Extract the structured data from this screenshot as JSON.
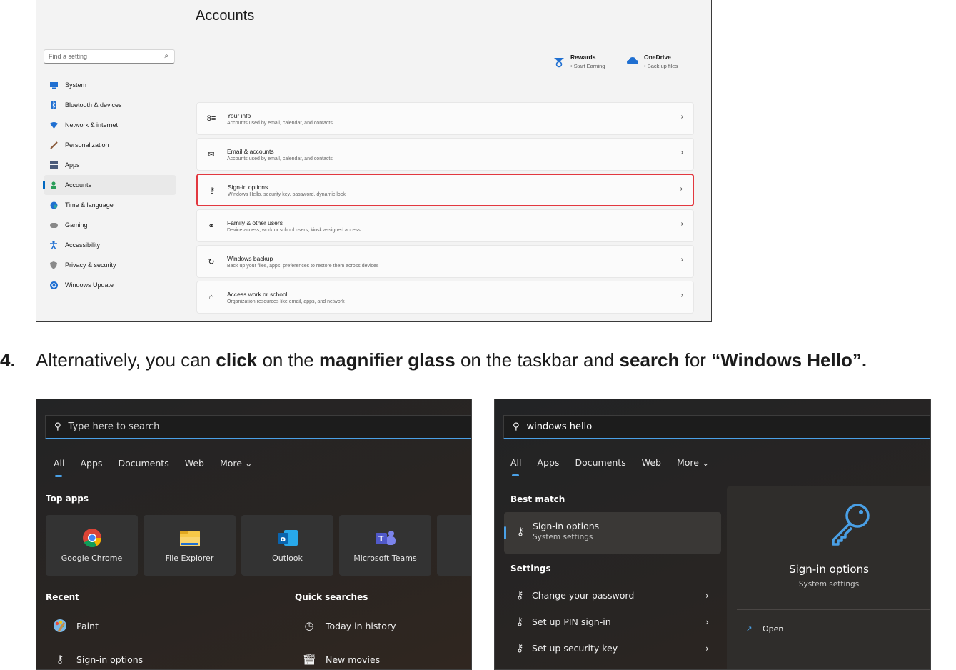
{
  "settings": {
    "title": "Accounts",
    "search_placeholder": "Find a setting",
    "nav": [
      {
        "label": "System",
        "icon": "monitor-icon",
        "color": "#1f6fd1"
      },
      {
        "label": "Bluetooth & devices",
        "icon": "bluetooth-icon",
        "color": "#1f6fd1"
      },
      {
        "label": "Network & internet",
        "icon": "wifi-icon",
        "color": "#1f6fd1"
      },
      {
        "label": "Personalization",
        "icon": "brush-icon",
        "color": "#8a5a3a"
      },
      {
        "label": "Apps",
        "icon": "apps-icon",
        "color": "#4a5a7a"
      },
      {
        "label": "Accounts",
        "icon": "person-icon",
        "color": "#2a9d58"
      },
      {
        "label": "Time & language",
        "icon": "globe-clock-icon",
        "color": "#1f6fd1"
      },
      {
        "label": "Gaming",
        "icon": "gamepad-icon",
        "color": "#777777"
      },
      {
        "label": "Accessibility",
        "icon": "accessibility-icon",
        "color": "#1f6fd1"
      },
      {
        "label": "Privacy & security",
        "icon": "shield-icon",
        "color": "#777777"
      },
      {
        "label": "Windows Update",
        "icon": "update-icon",
        "color": "#1f6fd1"
      }
    ],
    "active_nav": "Accounts",
    "promos": [
      {
        "title": "Rewards",
        "sub": "• Start Earning",
        "icon": "rewards-icon"
      },
      {
        "title": "OneDrive",
        "sub": "• Back up files",
        "icon": "cloud-icon"
      }
    ],
    "cards": [
      {
        "title": "Your info",
        "sub": "Accounts used by email, calendar, and contacts",
        "icon": "user-info-icon",
        "glyph": "8≡"
      },
      {
        "title": "Email & accounts",
        "sub": "Accounts used by email, calendar, and contacts",
        "icon": "mail-icon",
        "glyph": "✉"
      },
      {
        "title": "Sign-in options",
        "sub": "Windows Hello, security key, password, dynamic lock",
        "icon": "key-icon",
        "glyph": "⚷",
        "highlighted": true
      },
      {
        "title": "Family & other users",
        "sub": "Device access, work or school users, kiosk assigned access",
        "icon": "family-icon",
        "glyph": "⚭"
      },
      {
        "title": "Windows backup",
        "sub": "Back up your files, apps, preferences to restore them across devices",
        "icon": "backup-icon",
        "glyph": "↻"
      },
      {
        "title": "Access work or school",
        "sub": "Organization resources like email, apps, and network",
        "icon": "briefcase-icon",
        "glyph": "⌂"
      }
    ]
  },
  "instruction": {
    "number": "4.",
    "parts": [
      {
        "text": "Alternatively, you can ",
        "bold": false
      },
      {
        "text": "click",
        "bold": true
      },
      {
        "text": " on the ",
        "bold": false
      },
      {
        "text": "magnifier glass",
        "bold": true
      },
      {
        "text": " on the taskbar and ",
        "bold": false
      },
      {
        "text": "search",
        "bold": true
      },
      {
        "text": " for ",
        "bold": false
      },
      {
        "text": "“Windows Hello”.",
        "bold": true
      }
    ]
  },
  "search_left": {
    "placeholder": "Type here to search",
    "tabs": [
      "All",
      "Apps",
      "Documents",
      "Web",
      "More ⌄"
    ],
    "top_apps_label": "Top apps",
    "top_apps": [
      {
        "label": "Google Chrome",
        "icon": "chrome-icon"
      },
      {
        "label": "File Explorer",
        "icon": "folder-icon"
      },
      {
        "label": "Outlook",
        "icon": "outlook-icon"
      },
      {
        "label": "Microsoft Teams",
        "icon": "teams-icon"
      }
    ],
    "recent_label": "Recent",
    "recent": [
      {
        "label": "Paint",
        "icon": "paint-icon"
      },
      {
        "label": "Sign-in options",
        "icon": "key-icon"
      }
    ],
    "quick_label": "Quick searches",
    "quick": [
      {
        "label": "Today in history",
        "icon": "clock-icon"
      },
      {
        "label": "New movies",
        "icon": "clapper-icon"
      }
    ]
  },
  "search_right": {
    "query": "windows hello",
    "tabs": [
      "All",
      "Apps",
      "Documents",
      "Web",
      "More ⌄"
    ],
    "best_match_label": "Best match",
    "best_match": {
      "title": "Sign-in options",
      "sub": "System settings"
    },
    "settings_label": "Settings",
    "settings": [
      {
        "label": "Change your password"
      },
      {
        "label": "Set up PIN sign-in"
      },
      {
        "label": "Set up security key"
      }
    ],
    "preview": {
      "title": "Sign-in options",
      "sub": "System settings",
      "open_label": "Open"
    },
    "accent": "#4aa0e6"
  }
}
